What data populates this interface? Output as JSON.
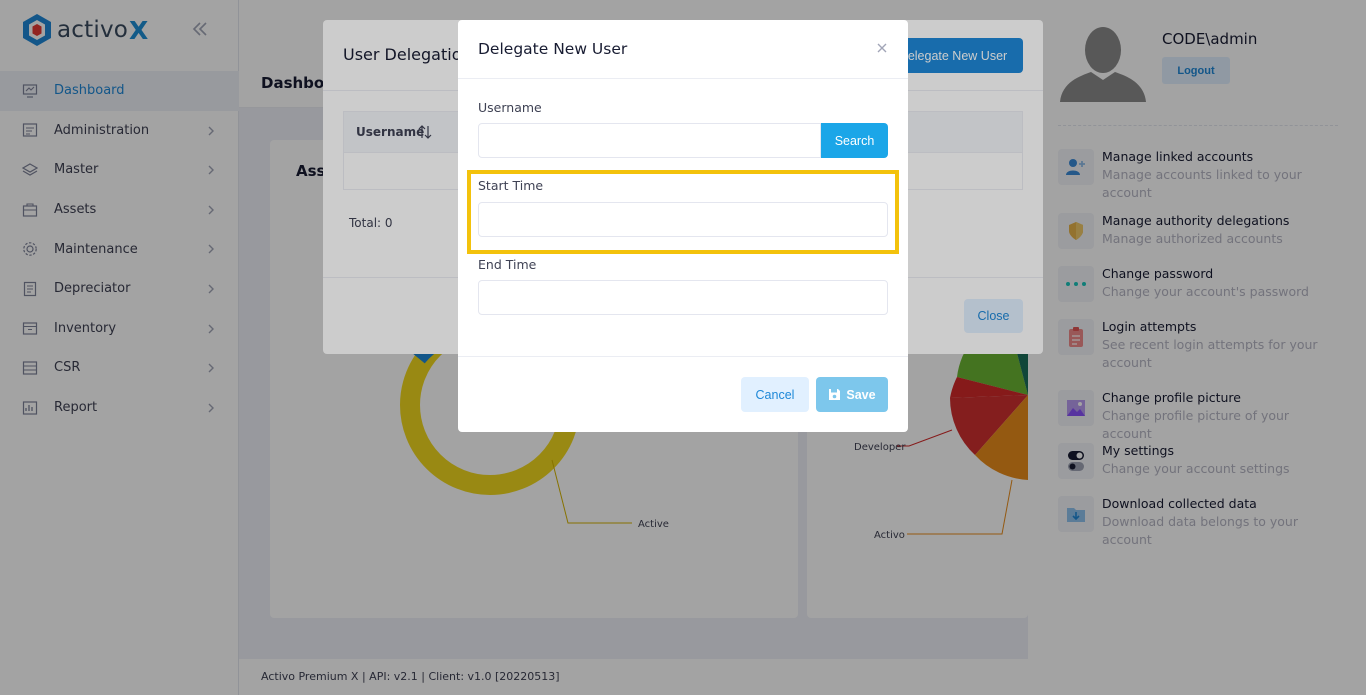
{
  "brand": {
    "name": "activo",
    "suffix": "X"
  },
  "sidebar": {
    "items": [
      {
        "label": "Dashboard",
        "icon": "dashboard-icon",
        "active": true
      },
      {
        "label": "Administration",
        "icon": "administration-icon"
      },
      {
        "label": "Master",
        "icon": "layers-icon"
      },
      {
        "label": "Assets",
        "icon": "assets-icon"
      },
      {
        "label": "Maintenance",
        "icon": "gear-icon"
      },
      {
        "label": "Depreciator",
        "icon": "depreciator-icon"
      },
      {
        "label": "Inventory",
        "icon": "inventory-icon"
      },
      {
        "label": "CSR",
        "icon": "csr-icon"
      },
      {
        "label": "Report",
        "icon": "report-icon"
      }
    ]
  },
  "main": {
    "subheader_title": "Dashboard",
    "card_left_title": "Asse",
    "chart_labels": {
      "active": "Active",
      "developer": "Developer",
      "activo": "Activo"
    },
    "footer": "Activo Premium X | API: v2.1 | Client: v1.0 [20220513]"
  },
  "profile": {
    "name": "CODE\\admin",
    "logout_label": "Logout",
    "items": [
      {
        "title": "Manage linked accounts",
        "desc": "Manage accounts linked to your account",
        "icon": "link-accounts-icon"
      },
      {
        "title": "Manage authority delegations",
        "desc": "Manage authorized accounts",
        "icon": "shield-icon"
      },
      {
        "title": "Change password",
        "desc": "Change your account's password",
        "icon": "password-dots-icon"
      },
      {
        "title": "Login attempts",
        "desc": "See recent login attempts for your account",
        "icon": "clipboard-icon"
      },
      {
        "title": "Change profile picture",
        "desc": "Change profile picture of your account",
        "icon": "picture-icon"
      },
      {
        "title": "My settings",
        "desc": "Change your account settings",
        "icon": "toggle-icon"
      },
      {
        "title": "Download collected data",
        "desc": "Download data belongs to your account",
        "icon": "download-folder-icon"
      }
    ]
  },
  "delegations_modal": {
    "title": "User Delegations",
    "new_button": "Delegate New User",
    "column_username": "Username",
    "total": "Total: 0",
    "close_label": "Close"
  },
  "delegate_modal": {
    "title": "Delegate New User",
    "username_label": "Username",
    "username_value": "",
    "search_label": "Search",
    "start_label": "Start Time",
    "start_value": "",
    "end_label": "End Time",
    "end_value": "",
    "cancel_label": "Cancel",
    "save_label": "Save"
  },
  "colors": {
    "accent": "#1e88d8",
    "search": "#1ba6e8",
    "highlight": "#f3c20c",
    "save_disabled": "#7dc7ec"
  }
}
